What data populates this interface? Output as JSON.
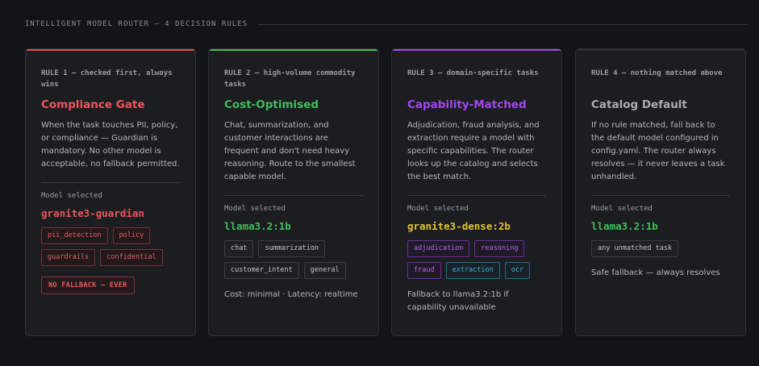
{
  "header": {
    "title": "INTELLIGENT MODEL ROUTER — 4 DECISION RULES"
  },
  "colors": {
    "rule1": "#f0545b",
    "rule2": "#3fbf58",
    "rule3": "#a346f2",
    "rule4": "#a9acb3",
    "background": "#131418"
  },
  "cards": [
    {
      "rule_label": "RULE 1 — checked first, always wins",
      "title": "Compliance Gate",
      "description": "When the task touches PII, policy, or compliance — Guardian is mandatory. No other model is acceptable, no fallback permitted.",
      "model_label": "Model selected",
      "model": "granite3-guardian",
      "tags": [
        "pii_detection",
        "policy",
        "guardrails",
        "confidential"
      ],
      "badge": "NO FALLBACK — EVER"
    },
    {
      "rule_label": "RULE 2 — high-volume commodity tasks",
      "title": "Cost-Optimised",
      "description": "Chat, summarization, and customer interactions are frequent and don't need heavy reasoning. Route to the smallest capable model.",
      "model_label": "Model selected",
      "model": "llama3.2:1b",
      "tags": [
        "chat",
        "summarization",
        "customer_intent",
        "general"
      ],
      "note": "Cost: minimal · Latency: realtime"
    },
    {
      "rule_label": "RULE 3 — domain-specific tasks",
      "title": "Capability-Matched",
      "description": "Adjudication, fraud analysis, and extraction require a model with specific capabilities. The router looks up the catalog and selects the best match.",
      "model_label": "Model selected",
      "model": "granite3-dense:2b",
      "tags": [
        "adjudication",
        "reasoning",
        "fraud",
        "extraction",
        "ocr"
      ],
      "note": "Fallback to llama3.2:1b if capability unavailable"
    },
    {
      "rule_label": "RULE 4 — nothing matched above",
      "title": "Catalog Default",
      "description": "If no rule matched, fall back to the default model configured in config.yaml. The router always resolves — it never leaves a task unhandled.",
      "model_label": "Model selected",
      "model": "llama3.2:1b",
      "tags": [
        "any unmatched task"
      ],
      "note": "Safe fallback — always resolves"
    }
  ]
}
